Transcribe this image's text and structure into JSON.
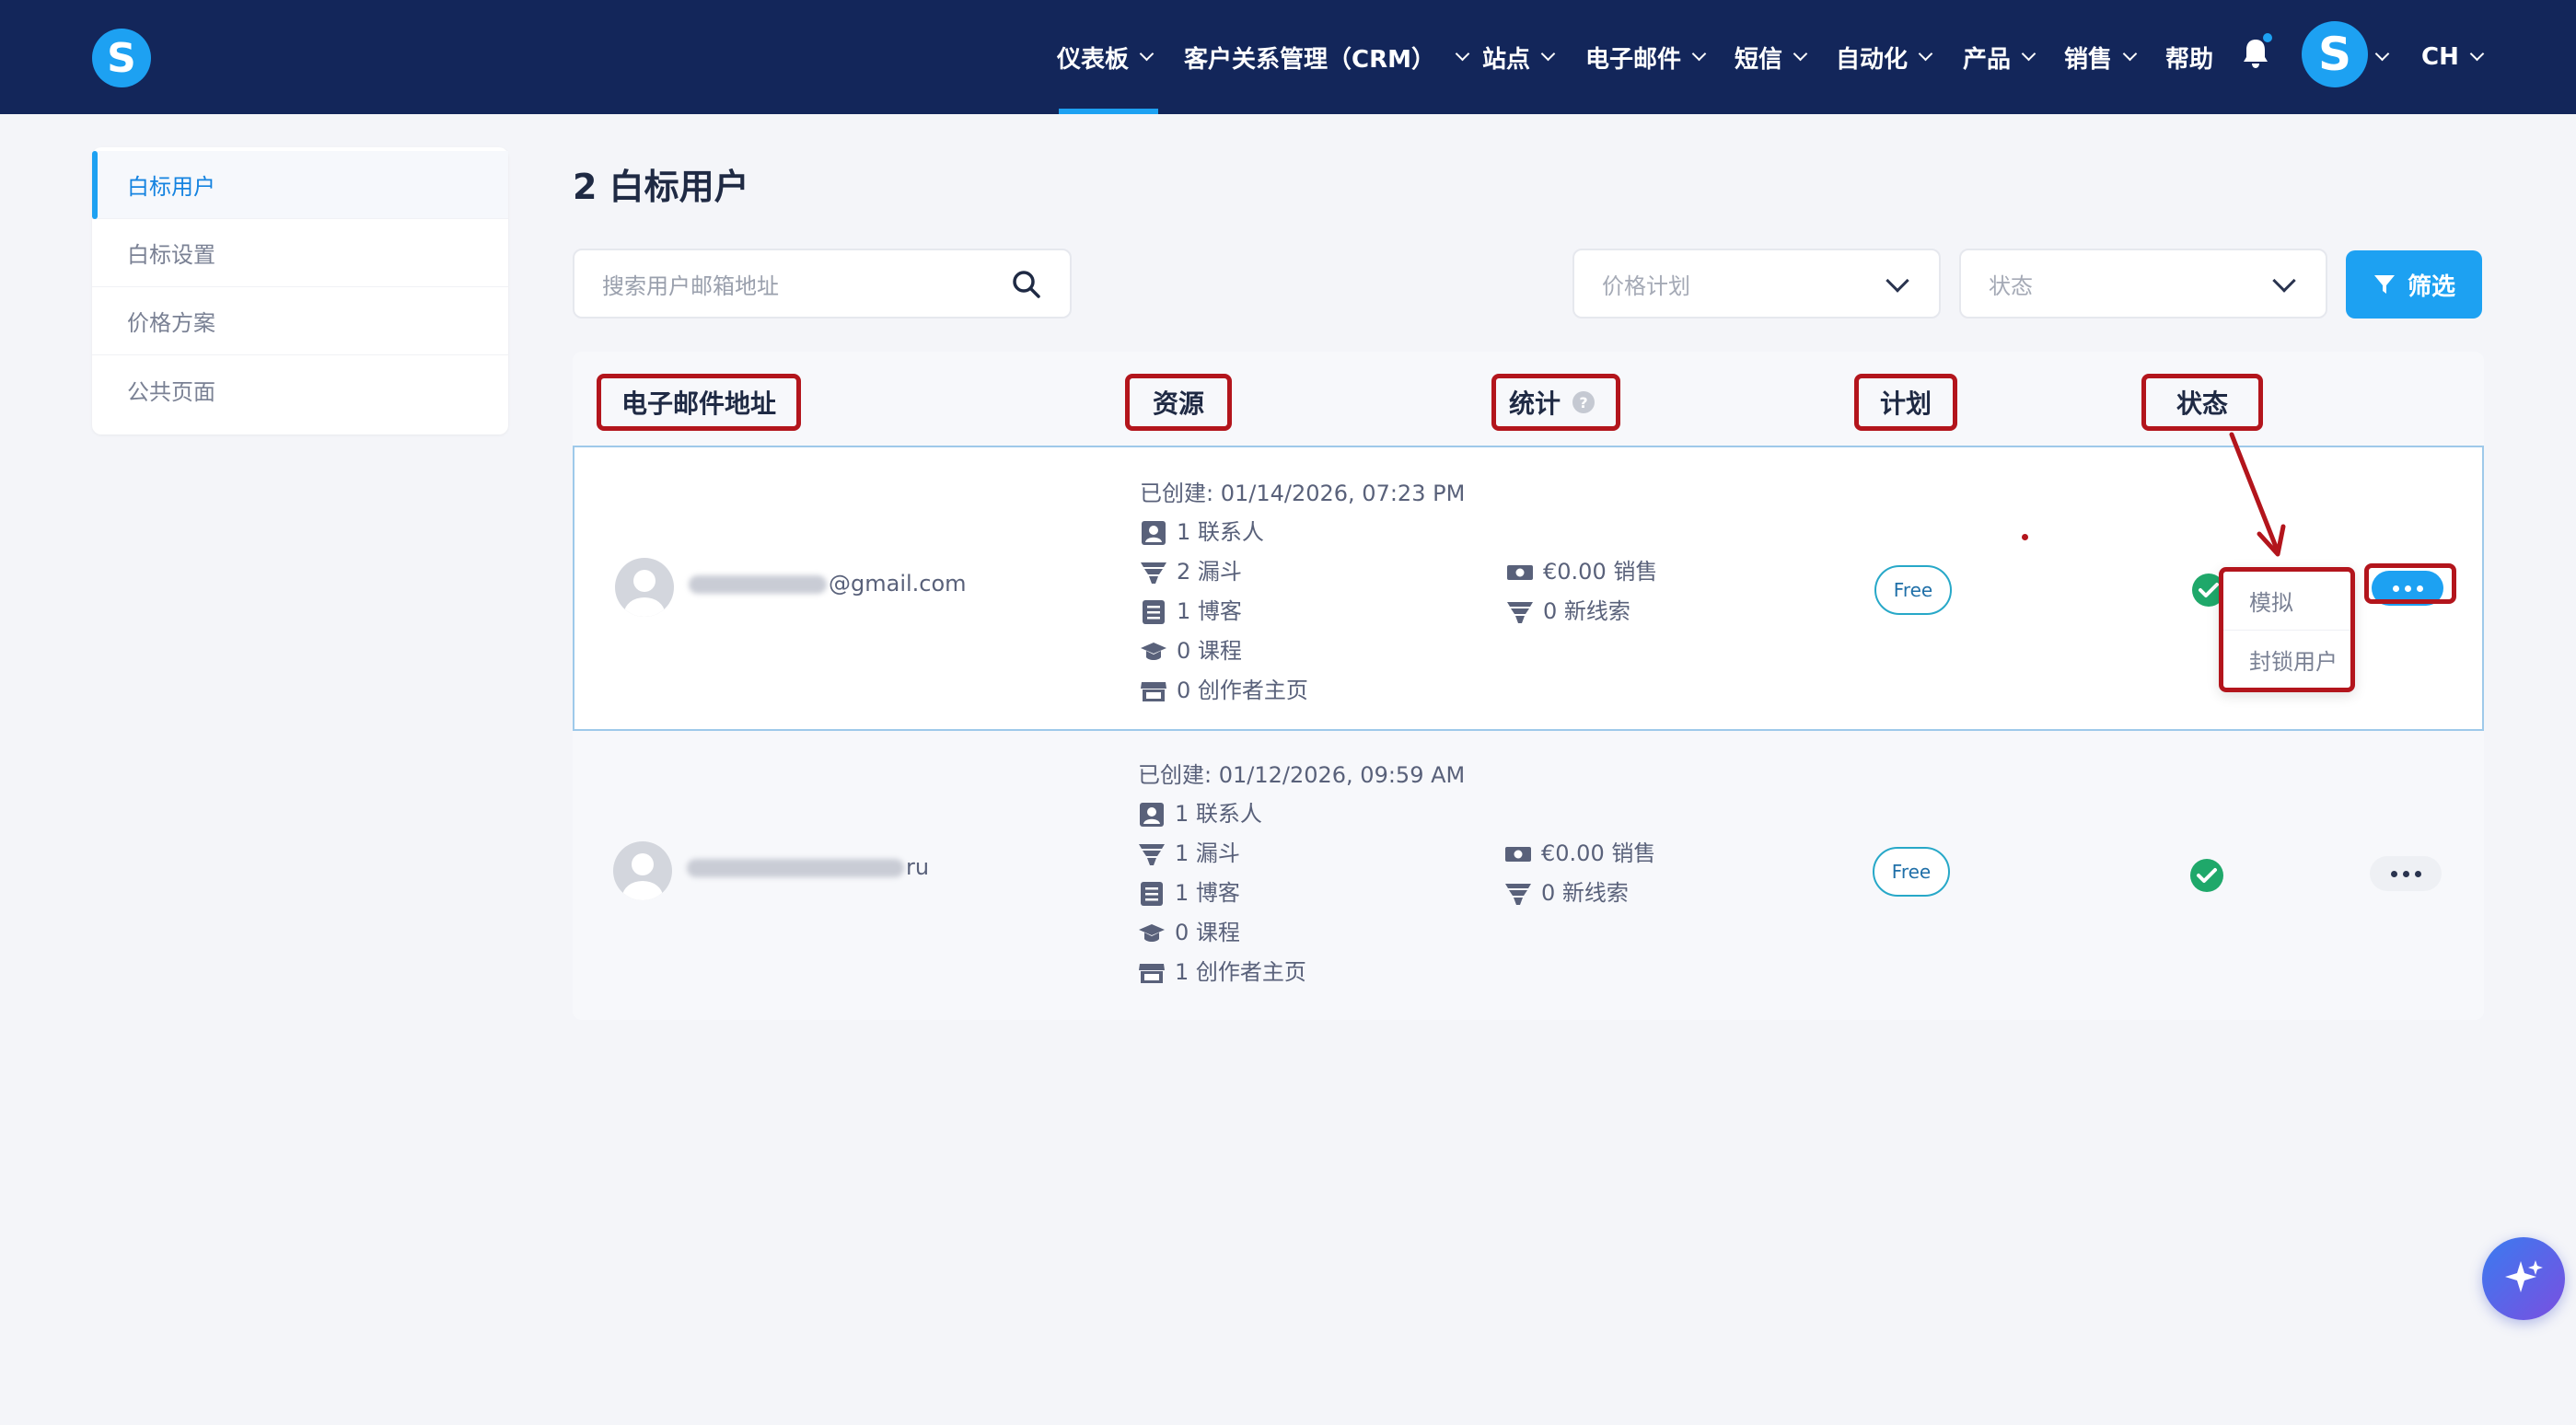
{
  "nav": {
    "items": [
      {
        "label": "仪表板"
      },
      {
        "label": "客户关系管理（CRM）"
      },
      {
        "label": "站点"
      },
      {
        "label": "电子邮件"
      },
      {
        "label": "短信"
      },
      {
        "label": "自动化"
      },
      {
        "label": "产品"
      },
      {
        "label": "销售"
      }
    ],
    "help": "帮助",
    "language": "CH",
    "logo_letter": "S",
    "avatar_letter": "S"
  },
  "sidebar": {
    "items": [
      {
        "label": "白标用户"
      },
      {
        "label": "白标设置"
      },
      {
        "label": "价格方案"
      },
      {
        "label": "公共页面"
      }
    ]
  },
  "page": {
    "title": "2 白标用户",
    "search_placeholder": "搜索用户邮箱地址",
    "plan_select": "价格计划",
    "status_select": "状态",
    "filter_label": "筛选"
  },
  "table": {
    "headers": [
      "电子邮件地址",
      "资源",
      "统计",
      "计划",
      "状态"
    ],
    "rows": [
      {
        "email_suffix": "@gmail.com",
        "created": "已创建: 01/14/2026, 07:23 PM",
        "contacts": "1 联系人",
        "funnels": "2 漏斗",
        "blogs": "1 博客",
        "courses": "0 课程",
        "creator": "0 创作者主页",
        "sales": "€0.00 销售",
        "leads": "0 新线索",
        "plan": "Free"
      },
      {
        "email_suffix": "ru",
        "created": "已创建: 01/12/2026, 09:59 AM",
        "contacts": "1 联系人",
        "funnels": "1 漏斗",
        "blogs": "1 博客",
        "courses": "0 课程",
        "creator": "1 创作者主页",
        "sales": "€0.00 销售",
        "leads": "0 新线索",
        "plan": "Free"
      }
    ]
  },
  "menu": {
    "impersonate": "模拟",
    "block": "封锁用户"
  },
  "colors": {
    "topbar": "#13265a",
    "accent": "#1da1f2",
    "annotation": "#b3151c",
    "success": "#1fa86a"
  }
}
